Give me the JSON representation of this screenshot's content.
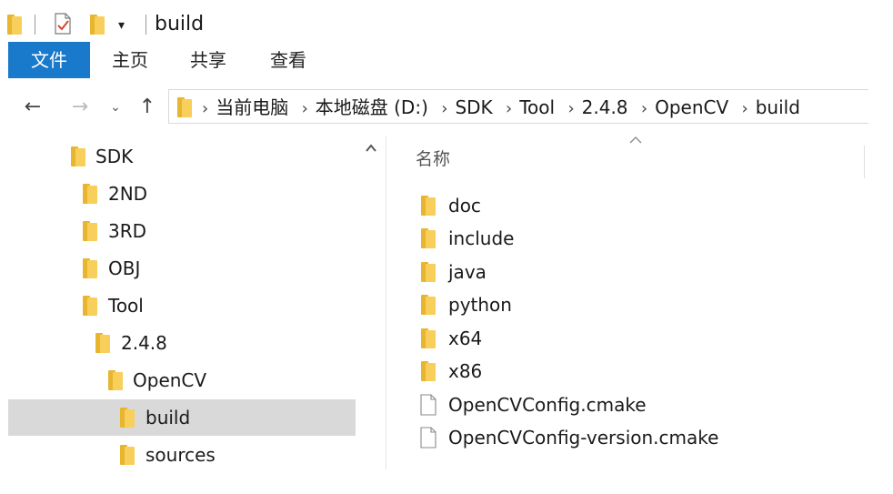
{
  "window": {
    "title": "build"
  },
  "quick_access": {
    "dropdown_glyph": "▾"
  },
  "ribbon": {
    "tabs": [
      {
        "label": "文件",
        "active": true
      },
      {
        "label": "主页"
      },
      {
        "label": "共享"
      },
      {
        "label": "查看"
      }
    ],
    "active_color": "#1979ca"
  },
  "nav": {
    "back_glyph": "←",
    "forward_glyph": "→",
    "recent_glyph": "⌄",
    "up_glyph": "↑"
  },
  "address": {
    "crumbs": [
      "当前电脑",
      "本地磁盘 (D:)",
      "SDK",
      "Tool",
      "2.4.8",
      "OpenCV",
      "build"
    ]
  },
  "tree": {
    "items": [
      {
        "label": "SDK",
        "depth": 0
      },
      {
        "label": "2ND",
        "depth": 1
      },
      {
        "label": "3RD",
        "depth": 1
      },
      {
        "label": "OBJ",
        "depth": 1
      },
      {
        "label": "Tool",
        "depth": 1
      },
      {
        "label": "2.4.8",
        "depth": 2
      },
      {
        "label": "OpenCV",
        "depth": 3
      },
      {
        "label": "build",
        "depth": 4,
        "selected": true
      },
      {
        "label": "sources",
        "depth": 4
      }
    ]
  },
  "list": {
    "column_name": "名称",
    "items": [
      {
        "name": "doc",
        "type": "folder"
      },
      {
        "name": "include",
        "type": "folder"
      },
      {
        "name": "java",
        "type": "folder"
      },
      {
        "name": "python",
        "type": "folder"
      },
      {
        "name": "x64",
        "type": "folder"
      },
      {
        "name": "x86",
        "type": "folder"
      },
      {
        "name": "OpenCVConfig.cmake",
        "type": "file"
      },
      {
        "name": "OpenCVConfig-version.cmake",
        "type": "file"
      }
    ]
  },
  "colors": {
    "folder_dark": "#e8b530",
    "folder_light": "#f7cf5a",
    "selection": "#d9d9d9"
  }
}
